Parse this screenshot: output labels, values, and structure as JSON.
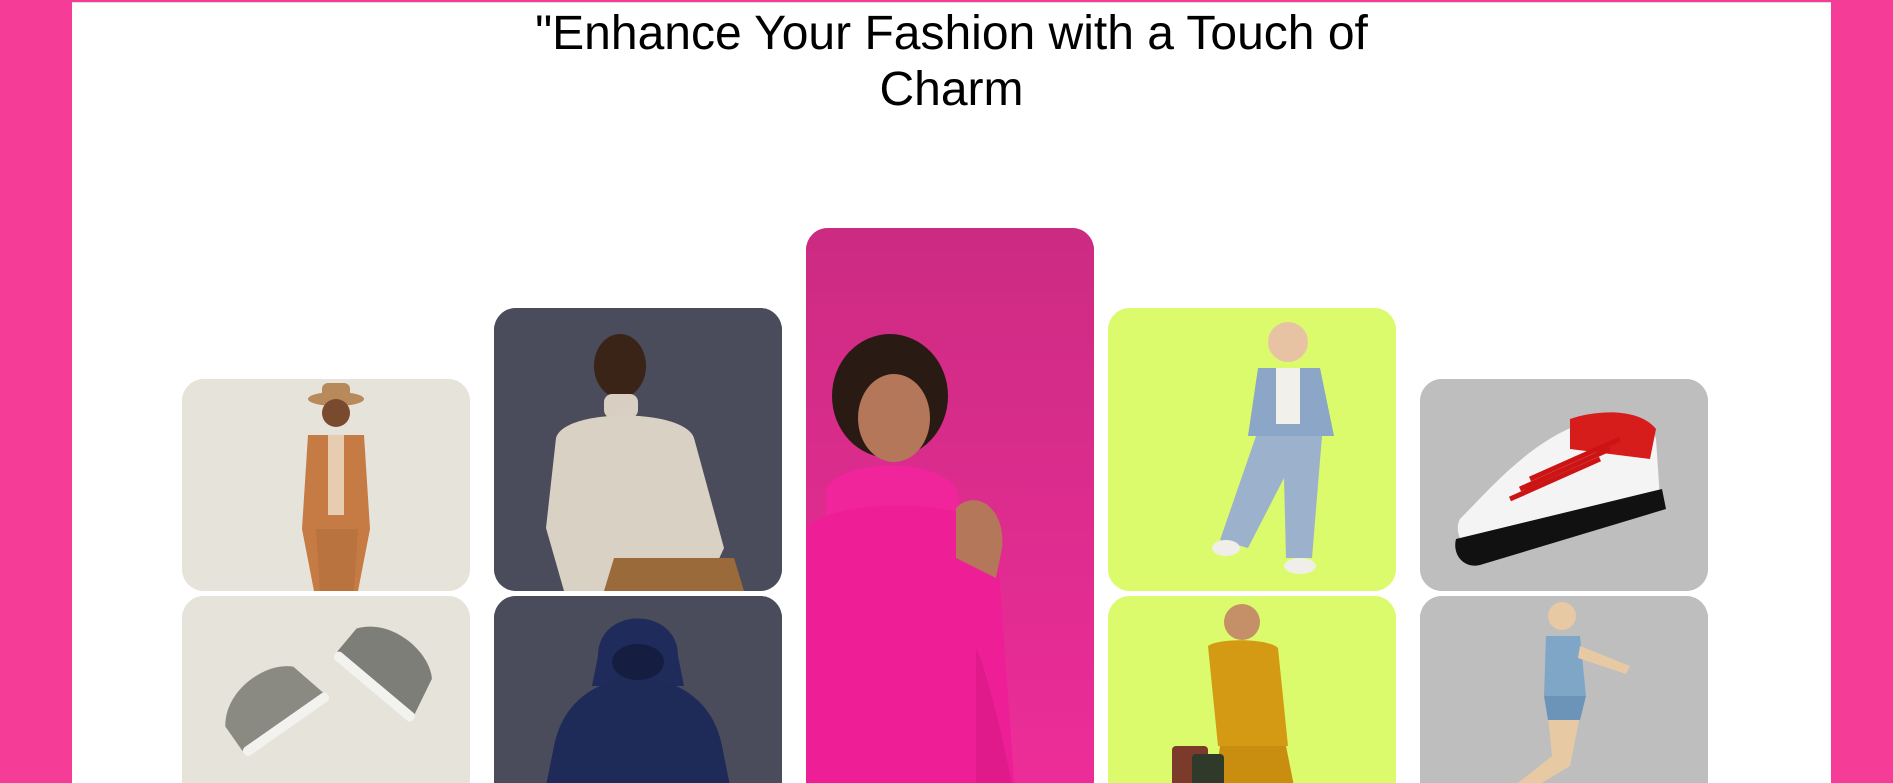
{
  "header": {
    "title": "\"Enhance Your Fashion with a Touch of Charm"
  },
  "gallery": {
    "tiles": [
      {
        "subject": "boy-in-hat-photo",
        "background": "#e5e3da"
      },
      {
        "subject": "man-in-turtleneck-photo",
        "background": "#4a4b5b"
      },
      {
        "subject": "woman-in-pink-photo",
        "background": "#e0248f"
      },
      {
        "subject": "child-in-denim-photo",
        "background": "#dbfb6c"
      },
      {
        "subject": "sneaker-red-photo",
        "background": "#bebebe"
      },
      {
        "subject": "sneakers-pair-photo",
        "background": "#e5e3da"
      },
      {
        "subject": "navy-hoodie-photo",
        "background": "#4a4b5b"
      },
      {
        "subject": "woman-shopping-photo",
        "background": "#dbfb6c"
      },
      {
        "subject": "girl-walking-photo",
        "background": "#bebebe"
      }
    ]
  },
  "colors": {
    "side_band": "#f53d98",
    "page_background": "#ffffff"
  }
}
